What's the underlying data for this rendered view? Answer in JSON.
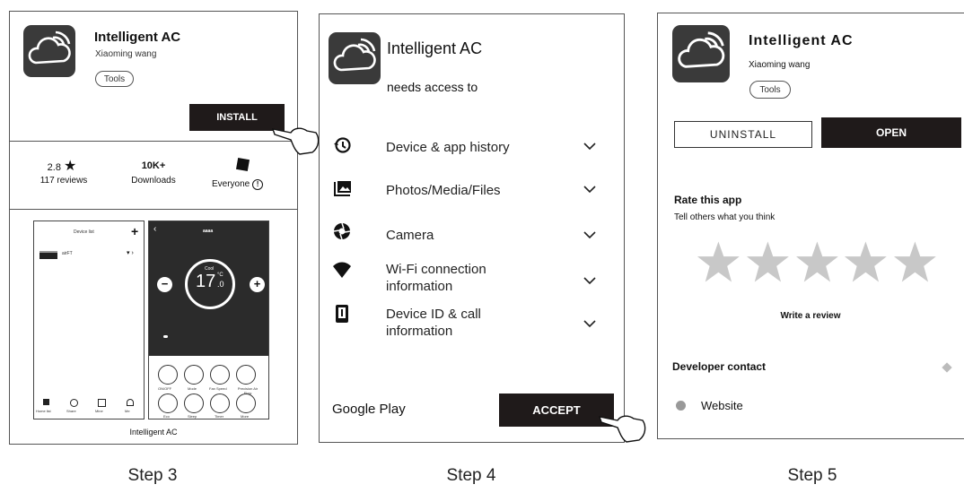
{
  "step3": {
    "app_title": "Intelligent AC",
    "developer": "Xiaoming wang",
    "category": "Tools",
    "install_label": "INSTALL",
    "rating_value": "2.8",
    "reviews_label": "117 reviews",
    "downloads_value": "10K+",
    "downloads_label": "Downloads",
    "content_rating": "Everyone",
    "screenshot_caption": "Intelligent AC",
    "phone_left": {
      "header": "Device list",
      "device_name": "airFT",
      "bottom_tabs": [
        "Home list",
        "Share",
        "Mine",
        "Me"
      ]
    },
    "phone_right": {
      "header": "aaaa",
      "mode": "Cool",
      "temperature": "17",
      "unit": "°C",
      "temperature_decimal": ".0",
      "buttons_row1": [
        "ON/OFF",
        "Mode",
        "Fan Speed",
        "Precision Air Flow"
      ],
      "buttons_row2": [
        "Eco",
        "Sleep",
        "Timer",
        "More"
      ]
    }
  },
  "step4": {
    "app_title": "Intelligent AC",
    "subtitle": "needs access to",
    "permissions": [
      {
        "label": "Device & app history",
        "icon": "history-icon"
      },
      {
        "label": "Photos/Media/Files",
        "icon": "photo-icon"
      },
      {
        "label": "Camera",
        "icon": "camera-icon"
      },
      {
        "label": "Wi-Fi connection information",
        "icon": "wifi-icon"
      },
      {
        "label": "Device ID & call information",
        "icon": "phone-icon"
      }
    ],
    "store_name": "Google Play",
    "accept_label": "ACCEPT"
  },
  "step5": {
    "app_title": "Intelligent AC",
    "developer": "Xiaoming wang",
    "category": "Tools",
    "uninstall_label": "UNINSTALL",
    "open_label": "OPEN",
    "rate_heading": "Rate this app",
    "rate_sub": "Tell others what you think",
    "stars_filled": 0,
    "stars_total": 5,
    "write_review": "Write a review",
    "developer_contact": "Developer contact",
    "website_label": "Website"
  },
  "step_labels": [
    "Step 3",
    "Step 4",
    "Step 5"
  ]
}
